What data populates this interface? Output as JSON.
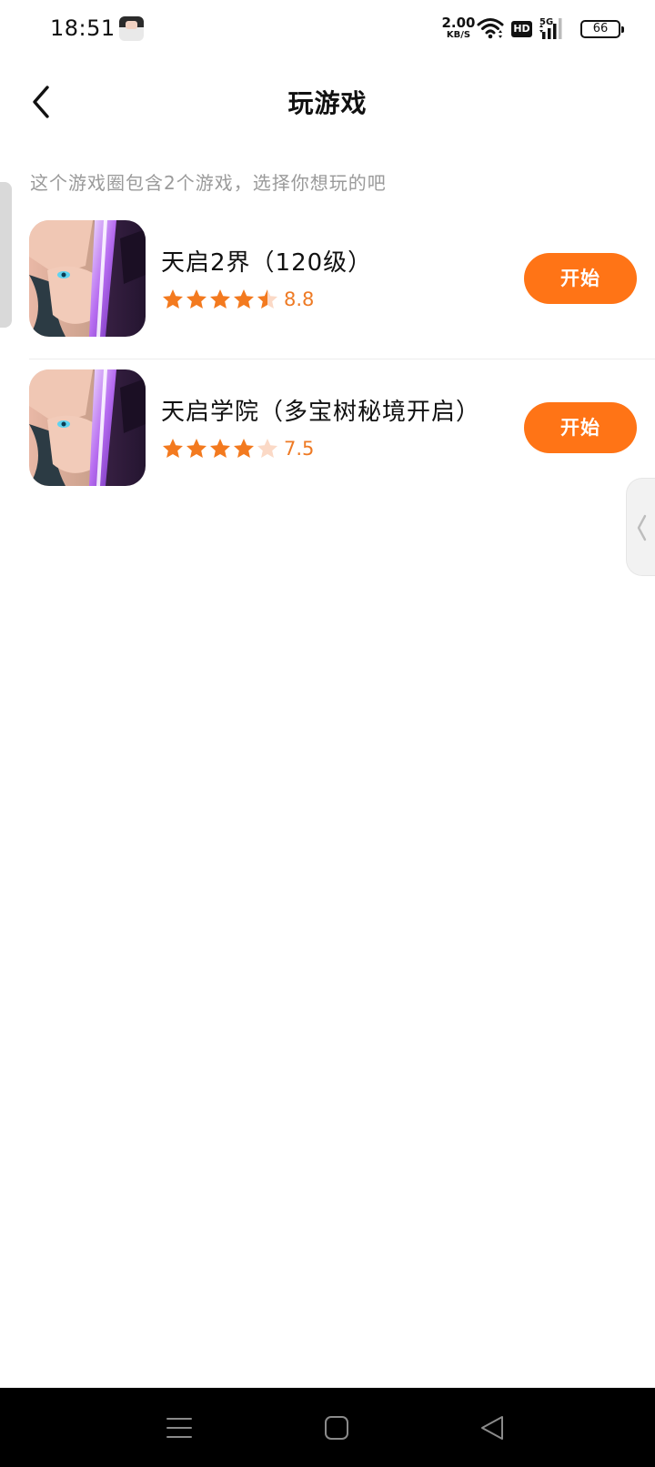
{
  "status_bar": {
    "time": "18:51",
    "net_speed_value": "2.00",
    "net_speed_unit": "KB/S",
    "hd_label": "HD",
    "network_type": "5G",
    "battery": "66"
  },
  "header": {
    "title": "玩游戏"
  },
  "subtitle": "这个游戏圈包含2个游戏，选择你想玩的吧",
  "games": [
    {
      "name": "天启2界（120级）",
      "rating": 8.8,
      "rating_text": "8.8",
      "stars": 4.5,
      "button": "开始"
    },
    {
      "name": "天启学院（多宝树秘境开启）",
      "rating": 7.5,
      "rating_text": "7.5",
      "stars": 4,
      "button": "开始"
    }
  ],
  "colors": {
    "accent": "#ff7416",
    "star_filled": "#f37a1f",
    "star_empty": "#fbd9c6",
    "subtitle": "#9a9a9a"
  },
  "icons": {
    "back": "chevron-left-icon",
    "side_handle": "chevron-left-icon",
    "nav_menu": "menu-icon",
    "nav_home": "square-icon",
    "nav_back": "triangle-back-icon"
  }
}
